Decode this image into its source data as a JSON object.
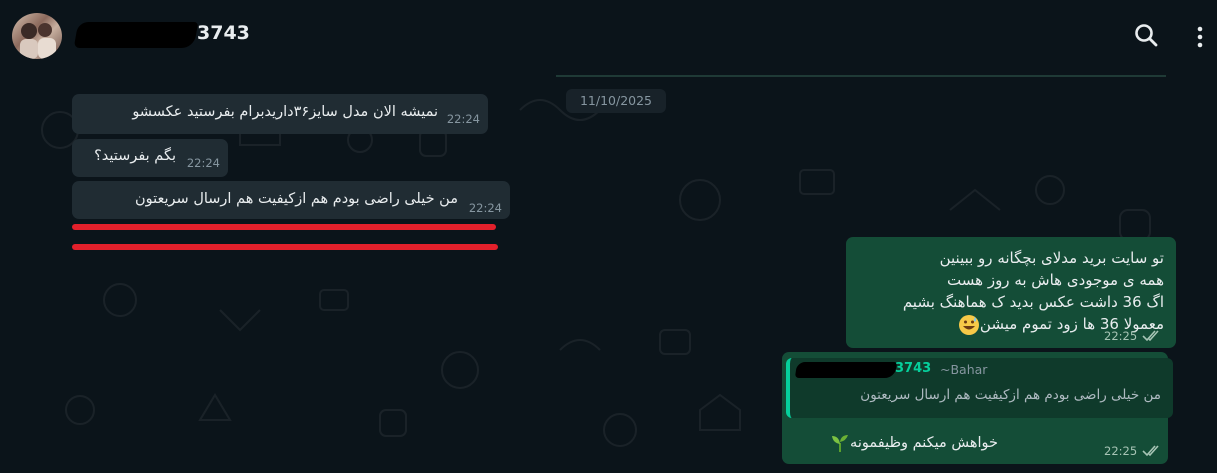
{
  "header": {
    "contact_name": "3743",
    "search_icon": "search-icon",
    "menu_icon": "more-vertical-icon"
  },
  "date_separator": "11/10/2025",
  "incoming": [
    {
      "text": "نمیشه الان مدل سایز۳۶دارید‌برام بفرستید عکسشو",
      "time": "22:24"
    },
    {
      "text": "بگم بفرستید؟",
      "time": "22:24"
    },
    {
      "text": "من خیلی راضی بودم هم ازکیفیت هم ارسال سریعتون",
      "time": "22:24"
    }
  ],
  "outgoing_1": {
    "lines": [
      "تو سایت برید مدلای بچگانه رو ببینین",
      "همه ی موجودی هاش به روز هست",
      "اگ 36 داشت عکس بدید ک هماهنگ بشیم",
      "معمولا 36 ها زود تموم میشن"
    ],
    "time": "22:25",
    "status_icon": "double-check-icon"
  },
  "outgoing_2": {
    "quoted_name": "3743",
    "quoted_alias": "~Bahar",
    "quoted_text": "من خیلی راضی بودم هم ازکیفیت هم ارسال سریعتون",
    "text": "خواهش میکنم وظیفمونه",
    "time": "22:25",
    "status_icon": "double-check-icon"
  },
  "colors": {
    "background": "#0b141a",
    "incoming_bubble": "#202c33",
    "outgoing_bubble": "#144d37",
    "accent": "#06cf9c",
    "annotation_red": "#e3202b"
  }
}
